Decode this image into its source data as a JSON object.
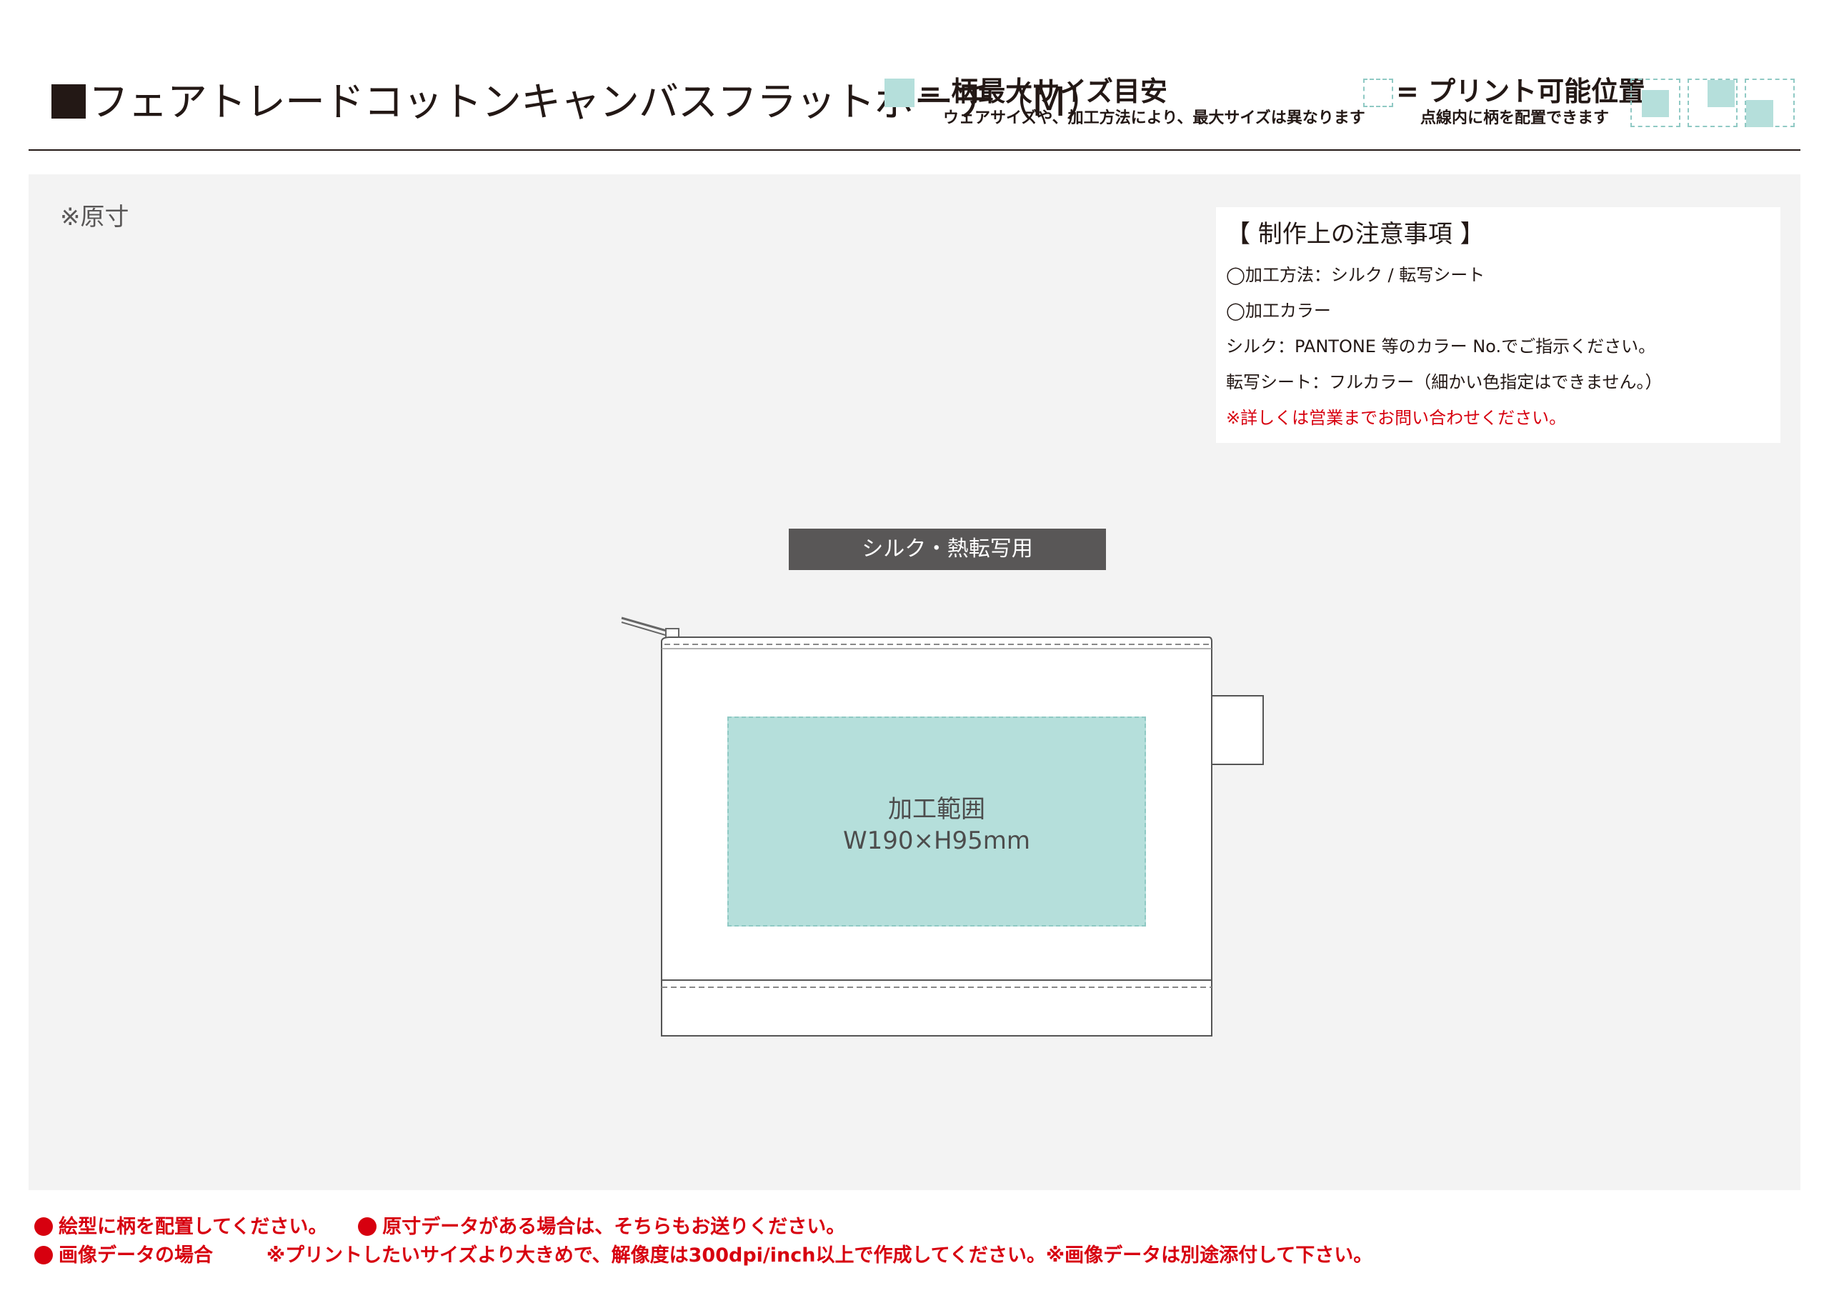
{
  "header": {
    "title_square": "■",
    "title": "フェアトレードコットンキャンバスフラットポーチ（M）",
    "legend_max": {
      "label": "= 柄最大サイズ目安",
      "note": "ウェアサイズや、加工方法により、最大サイズは異なります"
    },
    "legend_print": {
      "label": "= プリント可能位置",
      "note": "点線内に柄を配置できます"
    }
  },
  "canvas": {
    "scale_label": "※原寸",
    "tag_label": "シルク・熱転写用",
    "print_area": {
      "label": "加工範囲",
      "size": "W190×H95mm"
    }
  },
  "notes": {
    "heading": "【 制作上の注意事項 】",
    "lines": [
      "◯加工方法：シルク / 転写シート",
      "◯加工カラー",
      "シルク：PANTONE 等のカラー No.でご指示ください。",
      "転写シート：フルカラー（細かい色指定はできません。）"
    ],
    "contact": "※詳しくは営業までお問い合わせください。"
  },
  "footer": {
    "line1a": "絵型に柄を配置してください。",
    "line1b": "原寸データがある場合は、そちらもお送りください。",
    "line2a": "画像データの場合",
    "line2b": "※プリントしたいサイズより大きめで、解像度は300dpi/inch以上で作成してください。※画像データは別途添付して下さい。"
  },
  "colors": {
    "print_area": "#b5dfdb",
    "print_border": "#8fc9c4",
    "warning_red": "#d7000f",
    "tag_gray": "#595757",
    "canvas_bg": "#f3f3f3"
  }
}
